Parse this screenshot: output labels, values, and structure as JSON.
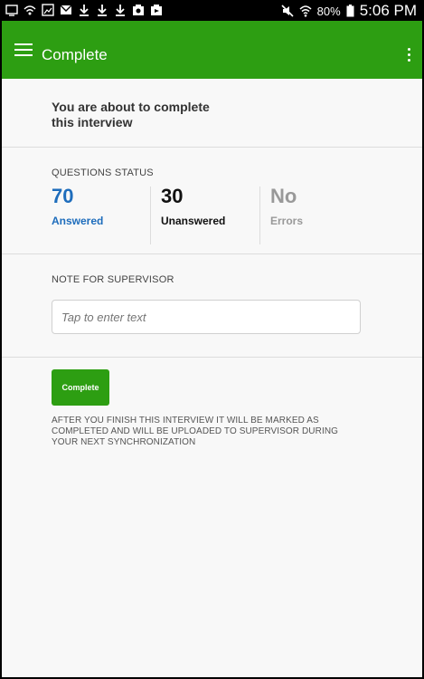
{
  "status_bar": {
    "battery_percent": "80%",
    "time": "5:06 PM",
    "left_icons": [
      "cast-icon",
      "wifi-call-icon",
      "image-icon",
      "mail-icon",
      "download-icon",
      "download-icon",
      "download-icon",
      "photo-icon",
      "video-icon"
    ],
    "right_icons": [
      "mute-icon",
      "wifi-icon",
      "battery-icon"
    ]
  },
  "app_bar": {
    "title": "Complete",
    "menu_icon": "hamburger-menu-icon",
    "more_icon": "overflow-menu-icon",
    "color": "#2d9e12"
  },
  "intro": {
    "text": "You are about to complete this interview"
  },
  "questions_status": {
    "label": "QUESTIONS STATUS",
    "stats": [
      {
        "value": "70",
        "caption": "Answered",
        "color": "#1e6dbc"
      },
      {
        "value": "30",
        "caption": "Unanswered",
        "color": "#111111"
      },
      {
        "value": "No",
        "caption": "Errors",
        "color": "#999999"
      }
    ]
  },
  "note": {
    "label": "NOTE FOR SUPERVISOR",
    "placeholder": "Tap to enter text",
    "value": ""
  },
  "complete_button": {
    "label": "Complete"
  },
  "after_text": "AFTER YOU FINISH THIS INTERVIEW IT WILL BE MARKED AS COMPLETED AND WILL BE UPLOADED TO SUPERVISOR DURING YOUR NEXT SYNCHRONIZATION"
}
